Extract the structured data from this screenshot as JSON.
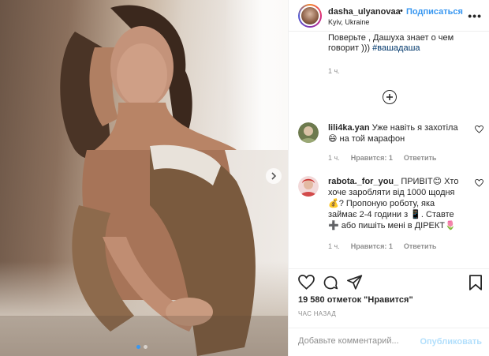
{
  "post": {
    "user": {
      "username": "dasha_ulyanovaa",
      "separator": "•",
      "follow_label": "Подписаться",
      "location": "Kyiv, Ukraine",
      "more_label": "•••",
      "avatar_icon": "user-avatar"
    },
    "media": {
      "slide_count": 2,
      "active_slide": 0,
      "next_icon": "chevron-right-icon"
    },
    "caption": {
      "text": "Поверьте , Дашуха знает о чем говорит )))",
      "hashtag": "#вашадаша",
      "time": "1 ч."
    },
    "load_more_icon": "plus-circle-icon",
    "comments": [
      {
        "username": "lili4ka.yan",
        "text": "Уже навіть я захотіла 😄 на той марафон",
        "time": "1 ч.",
        "reply_label": "Нравится: 1",
        "answer_label": "Ответить"
      },
      {
        "username": "rabota._for_you_",
        "text": "ПРИВІТ😊 Хто хоче заробляти від 1000 щодня 💰? Пропоную роботу, яка займає 2-4 години з 📱. Ставте ➕ або пишіть мені в ДІРЕКТ🌷",
        "time": "1 ч.",
        "reply_label": "Нравится: 1",
        "answer_label": "Ответить"
      }
    ],
    "actions": {
      "like_icon": "heart-icon",
      "comment_icon": "comment-icon",
      "share_icon": "share-icon",
      "save_icon": "bookmark-icon"
    },
    "likes_text": "19 580 отметок \"Нравится\"",
    "posted_ago": "ЧАС НАЗАД",
    "add_comment": {
      "placeholder": "Добавьте комментарий...",
      "publish_label": "Опубликовать"
    },
    "colors": {
      "accent": "#3897f0",
      "publish_disabled": "#b2dffc",
      "muted": "#8e8e8e",
      "text": "#262626"
    }
  }
}
